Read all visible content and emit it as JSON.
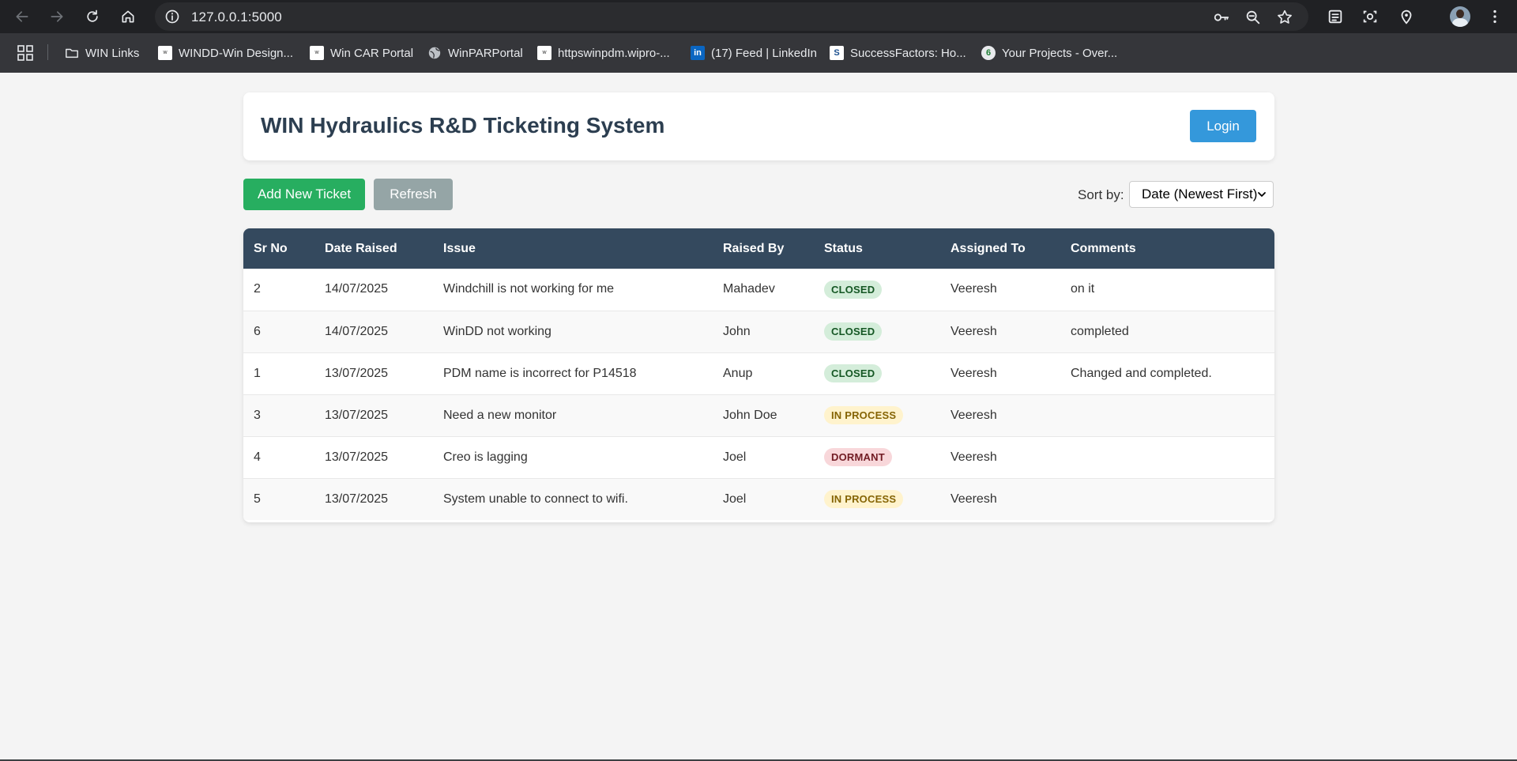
{
  "browser": {
    "url": "127.0.0.1:5000",
    "bookmarks": [
      {
        "label": "WIN Links",
        "icon": "folder-icon"
      },
      {
        "label": "WINDD-Win Design...",
        "icon": "wipro-favicon-icon"
      },
      {
        "label": "Win CAR Portal",
        "icon": "wipro-favicon-icon"
      },
      {
        "label": "WinPARPortal",
        "icon": "globe-icon"
      },
      {
        "label": "httpswinpdm.wipro-...",
        "icon": "wipro-favicon-icon"
      },
      {
        "label": "(17) Feed | LinkedIn",
        "icon": "linkedin-icon"
      },
      {
        "label": "SuccessFactors: Ho...",
        "icon": "successfactors-icon"
      },
      {
        "label": "Your Projects - Over...",
        "icon": "projects-favicon-icon"
      }
    ]
  },
  "header": {
    "title": "WIN Hydraulics R&D Ticketing System",
    "login_label": "Login"
  },
  "toolbar": {
    "add_label": "Add New Ticket",
    "refresh_label": "Refresh",
    "sort_label": "Sort by:",
    "sort_value": "Date (Newest First)"
  },
  "table": {
    "columns": [
      "Sr No",
      "Date Raised",
      "Issue",
      "Raised By",
      "Status",
      "Assigned To",
      "Comments"
    ],
    "rows": [
      {
        "sr": "2",
        "date": "14/07/2025",
        "issue": "Windchill is not working for me",
        "raised_by": "Mahadev",
        "status": "CLOSED",
        "assigned_to": "Veeresh",
        "comments": "on it"
      },
      {
        "sr": "6",
        "date": "14/07/2025",
        "issue": "WinDD not working",
        "raised_by": "John",
        "status": "CLOSED",
        "assigned_to": "Veeresh",
        "comments": "completed"
      },
      {
        "sr": "1",
        "date": "13/07/2025",
        "issue": "PDM name is incorrect for P14518",
        "raised_by": "Anup",
        "status": "CLOSED",
        "assigned_to": "Veeresh",
        "comments": "Changed and completed."
      },
      {
        "sr": "3",
        "date": "13/07/2025",
        "issue": "Need a new monitor",
        "raised_by": "John Doe",
        "status": "IN PROCESS",
        "assigned_to": "Veeresh",
        "comments": ""
      },
      {
        "sr": "4",
        "date": "13/07/2025",
        "issue": "Creo is lagging",
        "raised_by": "Joel",
        "status": "DORMANT",
        "assigned_to": "Veeresh",
        "comments": ""
      },
      {
        "sr": "5",
        "date": "13/07/2025",
        "issue": "System unable to connect to wifi.",
        "raised_by": "Joel",
        "status": "IN PROCESS",
        "assigned_to": "Veeresh",
        "comments": ""
      }
    ]
  },
  "colors": {
    "header_bg": "#34495e",
    "primary": "#3498db",
    "success": "#27ae60",
    "muted": "#95a5a6"
  }
}
